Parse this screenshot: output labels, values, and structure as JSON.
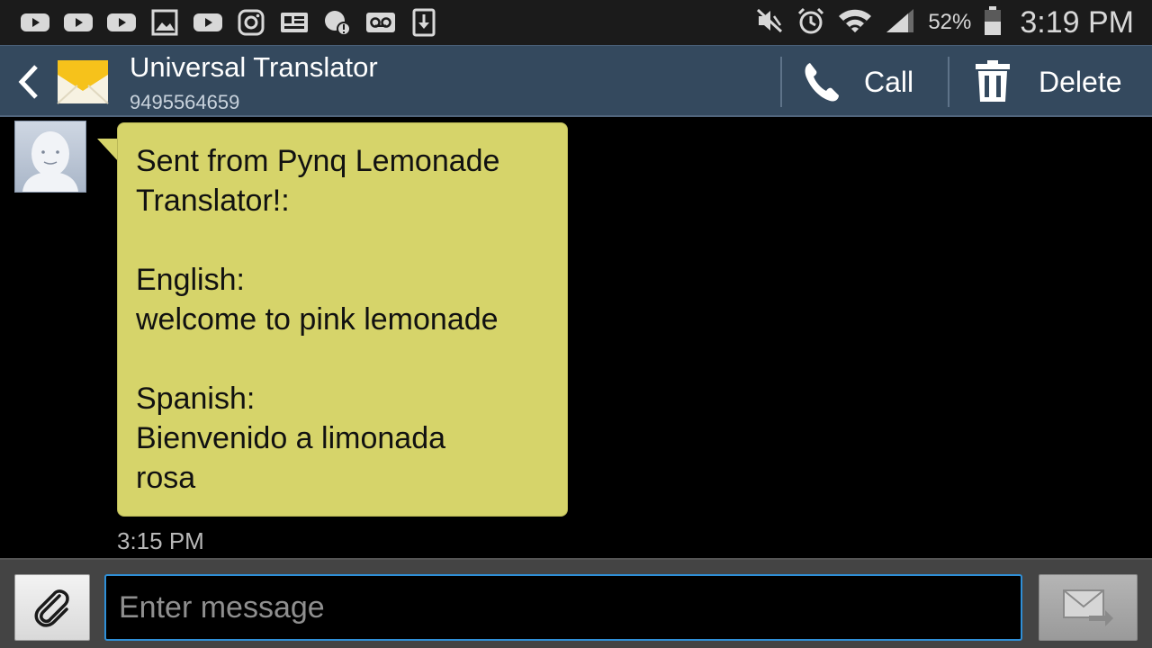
{
  "status_bar": {
    "notification_icons": [
      "youtube-icon",
      "youtube-icon",
      "youtube-icon",
      "gallery-icon",
      "youtube-icon",
      "instagram-icon",
      "news-icon",
      "app-alert-icon",
      "voicemail-icon",
      "download-icon"
    ],
    "system_icons": [
      "mute-icon",
      "alarm-icon",
      "wifi-icon",
      "signal-icon",
      "battery-icon"
    ],
    "battery_percent": "52%",
    "time": "3:19 PM"
  },
  "action_bar": {
    "title": "Universal Translator",
    "phone_number": "9495564659",
    "call_label": "Call",
    "delete_label": "Delete"
  },
  "conversation": {
    "message_lines": [
      "Sent from Pynq Lemonade",
      "Translator!:",
      "",
      "English:",
      "welcome to pink lemonade",
      "",
      "Spanish:",
      "Bienvenido a limonada",
      "rosa"
    ],
    "timestamp": "3:15 PM"
  },
  "composer": {
    "placeholder": "Enter message",
    "value": ""
  },
  "colors": {
    "action_bar": "#34495e",
    "bubble": "#d6d46a",
    "input_border": "#2f8fd7"
  }
}
